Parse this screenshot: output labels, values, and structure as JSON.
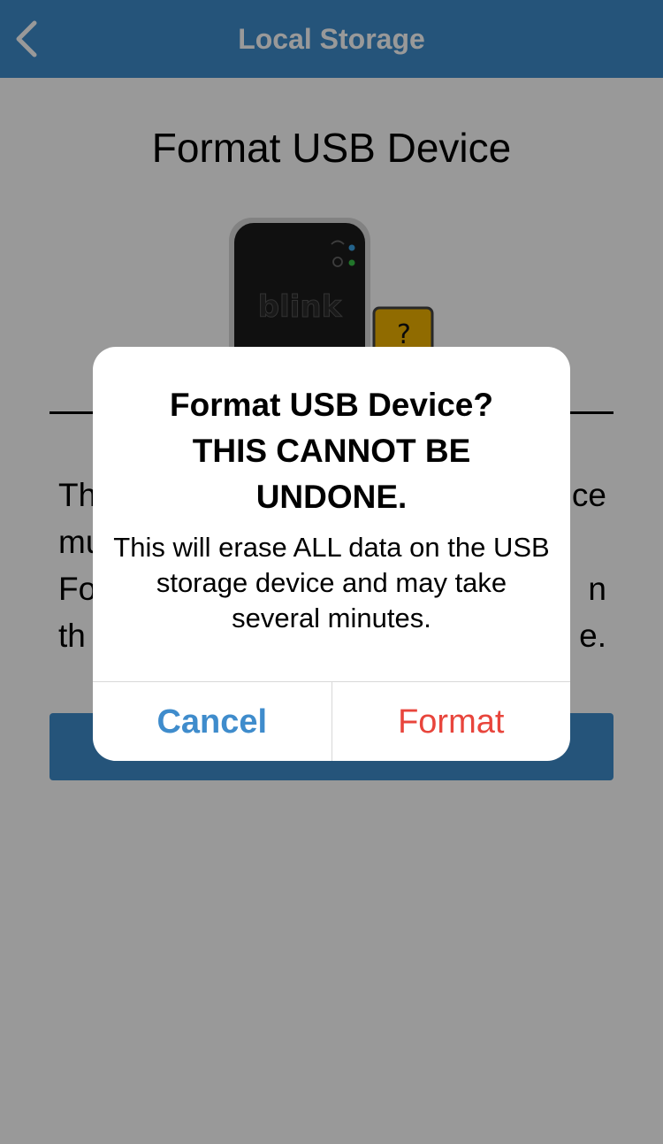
{
  "header": {
    "title": "Local Storage",
    "back_icon": "chevron-left-icon"
  },
  "page": {
    "title": "Format USB Device",
    "description_left": [
      "Th",
      "mu",
      "Fo",
      "th"
    ],
    "description_right": [
      "ce",
      "",
      "n",
      "e."
    ],
    "device_brand": "blink",
    "usb_badge": "?"
  },
  "dialog": {
    "title_line1": "Format USB Device?",
    "title_line2": "THIS CANNOT BE",
    "title_line3": "UNDONE.",
    "message": "This will erase ALL data on the USB storage device and may take several minutes.",
    "cancel_label": "Cancel",
    "confirm_label": "Format"
  },
  "colors": {
    "brand_blue": "#3f8ccc",
    "destructive_red": "#e8453c",
    "usb_yellow": "#f0b300"
  }
}
